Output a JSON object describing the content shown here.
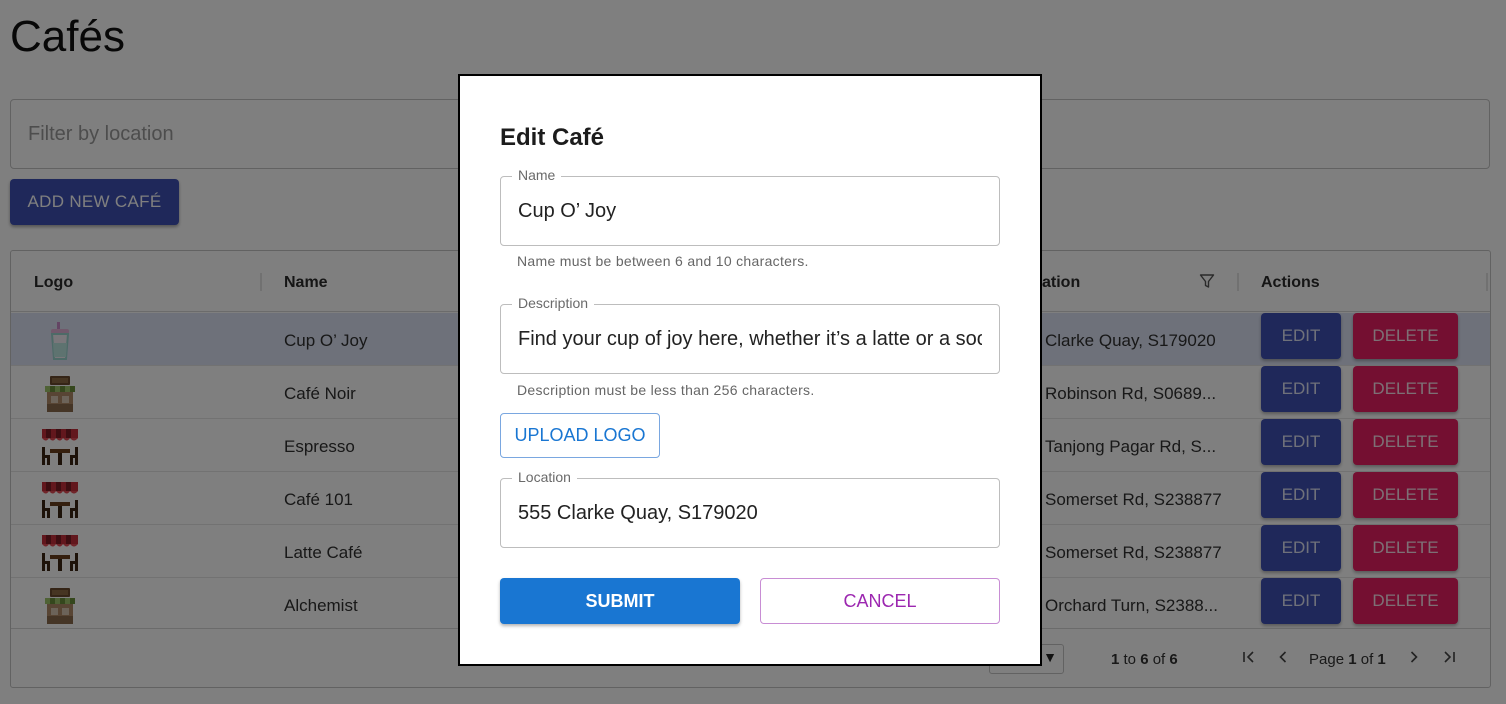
{
  "page": {
    "title": "Cafés",
    "filter_placeholder": "Filter by location",
    "add_button": "ADD NEW CAFÉ"
  },
  "grid": {
    "columns": {
      "logo": "Logo",
      "name": "Name",
      "location": "ation",
      "actions": "Actions"
    },
    "rows": [
      {
        "logo_icon": "cup-icon",
        "name": "Cup O’ Joy",
        "location": "Clarke Quay, S179020",
        "edit": "EDIT",
        "delete": "DELETE"
      },
      {
        "logo_icon": "cafe-storefront-icon",
        "name": "Café Noir",
        "location": "Robinson Rd, S0689...",
        "edit": "EDIT",
        "delete": "DELETE"
      },
      {
        "logo_icon": "awning-table-icon",
        "name": "Espresso",
        "location": "Tanjong Pagar Rd, S...",
        "edit": "EDIT",
        "delete": "DELETE"
      },
      {
        "logo_icon": "awning-table-icon",
        "name": "Café 101",
        "location": "Somerset Rd, S238877",
        "edit": "EDIT",
        "delete": "DELETE"
      },
      {
        "logo_icon": "awning-table-icon",
        "name": "Latte Café",
        "location": "Somerset Rd, S238877",
        "edit": "EDIT",
        "delete": "DELETE"
      },
      {
        "logo_icon": "cafe-storefront-icon",
        "name": "Alchemist",
        "location": "Orchard Turn, S2388...",
        "edit": "EDIT",
        "delete": "DELETE"
      }
    ],
    "footer": {
      "range_start": "1",
      "range_to": "to",
      "range_end": "6",
      "range_of": "of",
      "total": "6",
      "page_word": "Page",
      "current_page": "1",
      "page_of": "of",
      "total_pages": "1"
    }
  },
  "dialog": {
    "title": "Edit Café",
    "name_label": "Name",
    "name_value": "Cup O’ Joy",
    "name_helper": "Name must be between 6 and 10 characters.",
    "description_label": "Description",
    "description_value": "Find your cup of joy here, whether it’s a latte or a soothing tea.",
    "description_helper": "Description must be less than 256 characters.",
    "upload_button": "UPLOAD LOGO",
    "location_label": "Location",
    "location_value": "555 Clarke Quay, S179020",
    "submit_button": "SUBMIT",
    "cancel_button": "CANCEL"
  },
  "colors": {
    "primary": "#3f51b5",
    "secondary": "#e91e63",
    "dialog_primary": "#1976d2",
    "dialog_secondary": "#9c27b0",
    "selected_row": "#dde3f5"
  }
}
